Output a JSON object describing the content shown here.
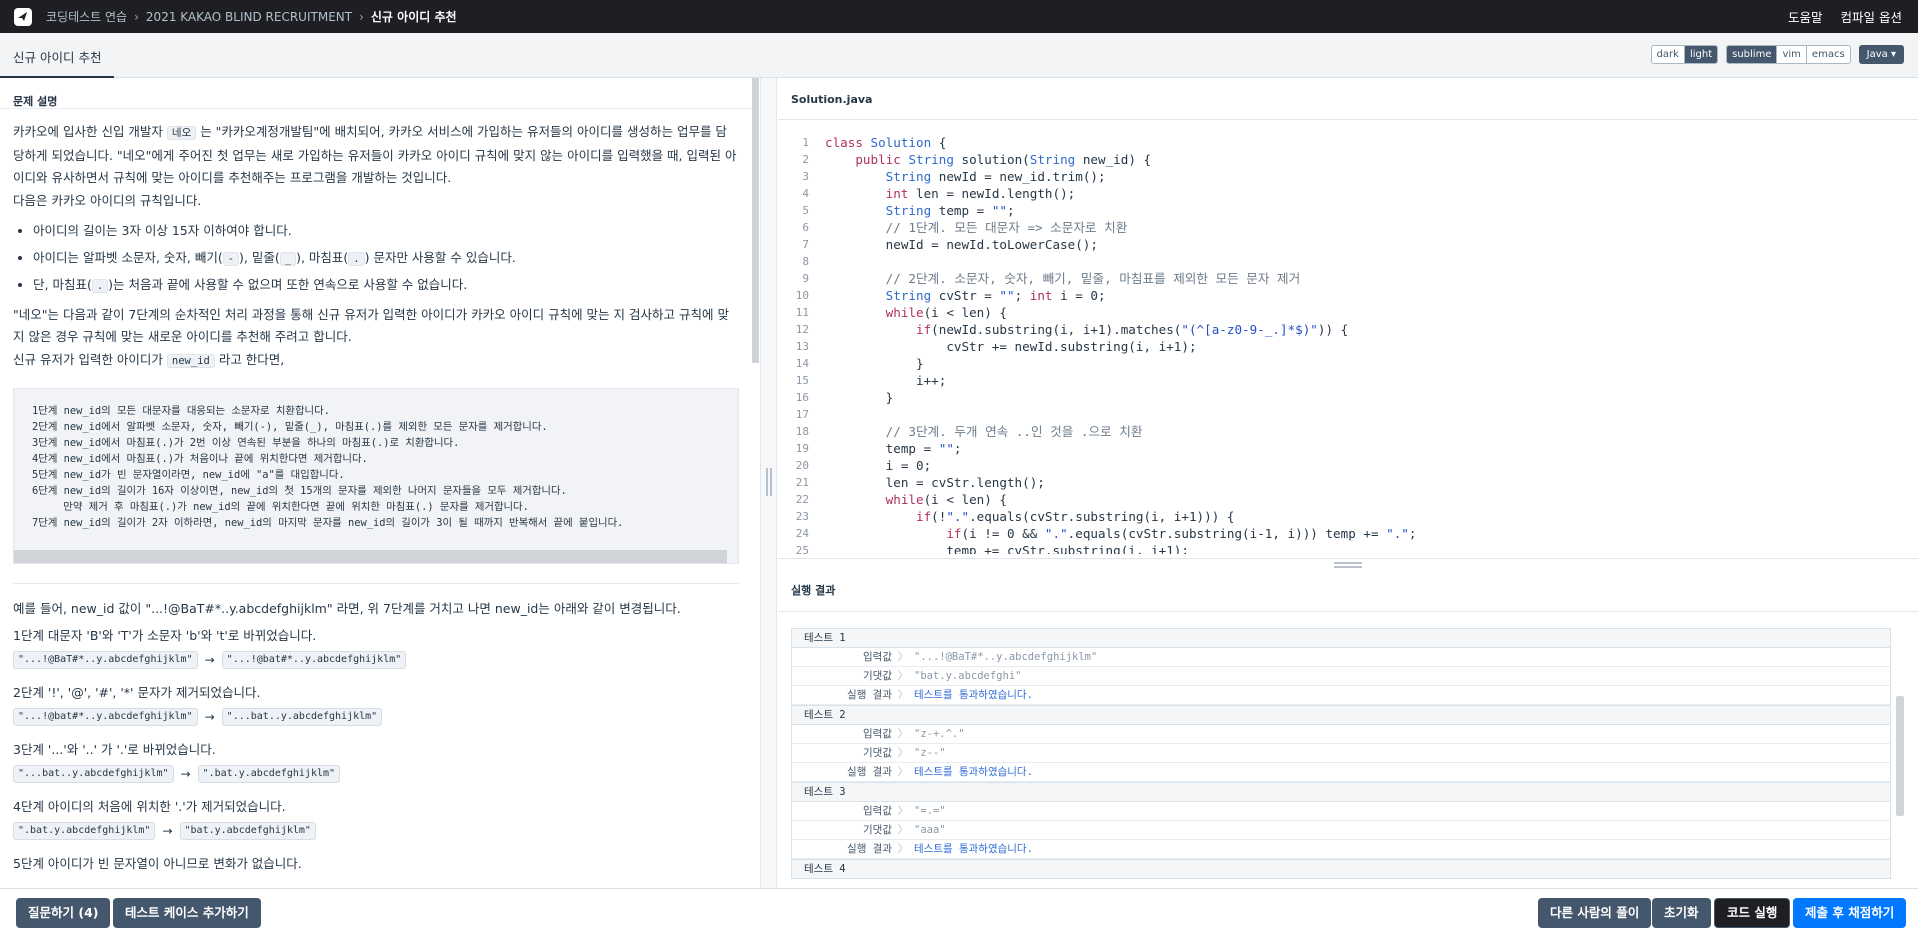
{
  "topbar": {
    "breadcrumbs": [
      "코딩테스트 연습",
      "2021 KAKAO BLIND RECRUITMENT",
      "신규 아이디 추천"
    ],
    "help_label": "도움말",
    "compile_options_label": "컴파일 옵션"
  },
  "titlebar": {
    "tab_title": "신규 아이디 추천",
    "themes": [
      "dark",
      "light"
    ],
    "selected_theme": "light",
    "keymaps": [
      "sublime",
      "vim",
      "emacs"
    ],
    "selected_keymap": "sublime",
    "language": "Java",
    "language_caret": "▾"
  },
  "problem": {
    "section_title": "문제 설명",
    "para1_a": "카카오에 입사한 신입 개발자 ",
    "para1_code": "네오",
    "para1_b": " 는 \"카카오계정개발팀\"에 배치되어, 카카오 서비스에 가입하는 유저들의 아이디를 생성하는 업무를 담당하게 되었습니다. \"네오\"에게 주어진 첫 업무는 새로 가입하는 유저들이 카카오 아이디 규칙에 맞지 않는 아이디를 입력했을 때, 입력된 아이디와 유사하면서 규칙에 맞는 아이디를 추천해주는 프로그램을 개발하는 것입니다.",
    "para2": "다음은 카카오 아이디의 규칙입니다.",
    "rule1": "아이디의 길이는 3자 이상 15자 이하여야 합니다.",
    "rule2_a": "아이디는 알파벳 소문자, 숫자, 빼기(",
    "rule2_c1": "-",
    "rule2_b": "), 밑줄(",
    "rule2_c2": "_",
    "rule2_c": "), 마침표(",
    "rule2_c3": ".",
    "rule2_d": ") 문자만 사용할 수 있습니다.",
    "rule3_a": "단, 마침표(",
    "rule3_c": ".",
    "rule3_b": ")는 처음과 끝에 사용할 수 없으며 또한 연속으로 사용할 수 없습니다.",
    "para3": "\"네오\"는 다음과 같이 7단계의 순차적인 처리 과정을 통해 신규 유저가 입력한 아이디가 카카오 아이디 규칙에 맞는 지 검사하고 규칙에 맞지 않은 경우 규칙에 맞는 새로운 아이디를 추천해 주려고 합니다.",
    "para4_a": "신규 유저가 입력한 아이디가 ",
    "para4_code": "new_id",
    "para4_b": " 라고 한다면,",
    "steps": "1단계 new_id의 모든 대문자를 대응되는 소문자로 치환합니다.\n2단계 new_id에서 알파벳 소문자, 숫자, 빼기(-), 밑줄(_), 마침표(.)를 제외한 모든 문자를 제거합니다.\n3단계 new_id에서 마침표(.)가 2번 이상 연속된 부분을 하나의 마침표(.)로 치환합니다.\n4단계 new_id에서 마침표(.)가 처음이나 끝에 위치한다면 제거합니다.\n5단계 new_id가 빈 문자열이라면, new_id에 \"a\"를 대입합니다.\n6단계 new_id의 길이가 16자 이상이면, new_id의 첫 15개의 문자를 제외한 나머지 문자들을 모두 제거합니다.\n     만약 제거 후 마침표(.)가 new_id의 끝에 위치한다면 끝에 위치한 마침표(.) 문자를 제거합니다.\n7단계 new_id의 길이가 2자 이하라면, new_id의 마지막 문자를 new_id의 길이가 3이 될 때까지 반복해서 끝에 붙입니다.",
    "example_intro": "예를 들어, new_id 값이 \"...!@BaT#*..y.abcdefghijklm\" 라면, 위 7단계를 거치고 나면 new_id는 아래와 같이 변경됩니다.",
    "examples": [
      {
        "desc": "1단계 대문자 'B'와 'T'가 소문자 'b'와 't'로 바뀌었습니다.",
        "from": "\"...!@BaT#*..y.abcdefghijklm\"",
        "to": "\"...!@bat#*..y.abcdefghijklm\""
      },
      {
        "desc": "2단계 '!', '@', '#', '*' 문자가 제거되었습니다.",
        "from": "\"...!@bat#*..y.abcdefghijklm\"",
        "to": "\"...bat..y.abcdefghijklm\""
      },
      {
        "desc": "3단계 '...'와 '..' 가 '.'로 바뀌었습니다.",
        "from": "\"...bat..y.abcdefghijklm\"",
        "to": "\".bat.y.abcdefghijklm\""
      },
      {
        "desc": "4단계 아이디의 처음에 위치한 '.'가 제거되었습니다.",
        "from": "\".bat.y.abcdefghijklm\"",
        "to": "\"bat.y.abcdefghijklm\""
      },
      {
        "desc": "5단계 아이디가 빈 문자열이 아니므로 변화가 없습니다."
      }
    ],
    "arrow": "→"
  },
  "editor": {
    "filename": "Solution.java",
    "line_numbers": [
      "1",
      "2",
      "3",
      "4",
      "5",
      "6",
      "7",
      "8",
      "9",
      "10",
      "11",
      "12",
      "13",
      "14",
      "15",
      "16",
      "17",
      "18",
      "19",
      "20",
      "21",
      "22",
      "23",
      "24",
      "25"
    ]
  },
  "results": {
    "title": "실행 결과",
    "labels": {
      "input": "입력값",
      "expected": "기댓값",
      "result": "실행 결과",
      "chevron": "〉"
    },
    "cases": [
      {
        "name": "테스트 1",
        "input": "\"...!@BaT#*..y.abcdefghijklm\"",
        "expected": "\"bat.y.abcdefghi\"",
        "result": "테스트를 통과하였습니다."
      },
      {
        "name": "테스트 2",
        "input": "\"z-+.^.\"",
        "expected": "\"z--\"",
        "result": "테스트를 통과하였습니다."
      },
      {
        "name": "테스트 3",
        "input": "\"=.=\"",
        "expected": "\"aaa\"",
        "result": "테스트를 통과하였습니다."
      },
      {
        "name": "테스트 4"
      }
    ]
  },
  "bottombar": {
    "ask_label": "질문하기 (4)",
    "add_testcase_label": "테스트 케이스 추가하기",
    "others_solution_label": "다른 사람의 풀이",
    "reset_label": "초기화",
    "run_label": "코드 실행",
    "submit_label": "제출 후 채점하기"
  },
  "colors": {
    "topbar_bg": "#1e1e23",
    "primary": "#0078ff",
    "button_gray": "#44576c",
    "pass_text": "#2f6bd8"
  }
}
